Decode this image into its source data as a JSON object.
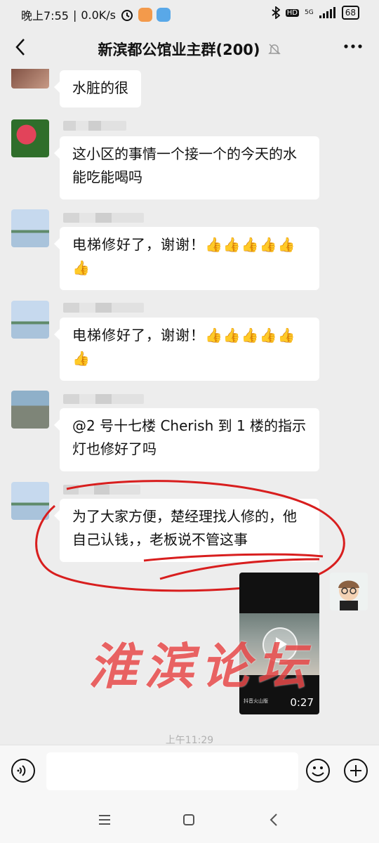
{
  "status_bar": {
    "time": "晚上7:55",
    "net_speed": "0.0K/s",
    "network": "5G",
    "battery": "68"
  },
  "header": {
    "title": "新滨都公馆业主群(200)"
  },
  "messages": [
    {
      "text": "水脏的很"
    },
    {
      "text": "这小区的事情一个接一个的今天的水能吃能喝吗"
    },
    {
      "text": "电梯修好了，谢谢！👍👍👍👍👍👍"
    },
    {
      "text": "电梯修好了，谢谢！👍👍👍👍👍👍"
    },
    {
      "text": "@2 号十七楼 Cherish  到 1 楼的指示灯也修好了吗"
    },
    {
      "text": "为了大家方便，楚经理找人修的，他自己认钱，，老板说不管这事"
    }
  ],
  "video": {
    "duration": "0:27",
    "mark": "抖音火山版"
  },
  "watermark": "淮滨论坛",
  "timestamp": "上午11:29",
  "input": {
    "placeholder": ""
  },
  "colors": {
    "annotation": "#d81e1e",
    "bubble": "#ffffff",
    "background": "#ededed"
  }
}
